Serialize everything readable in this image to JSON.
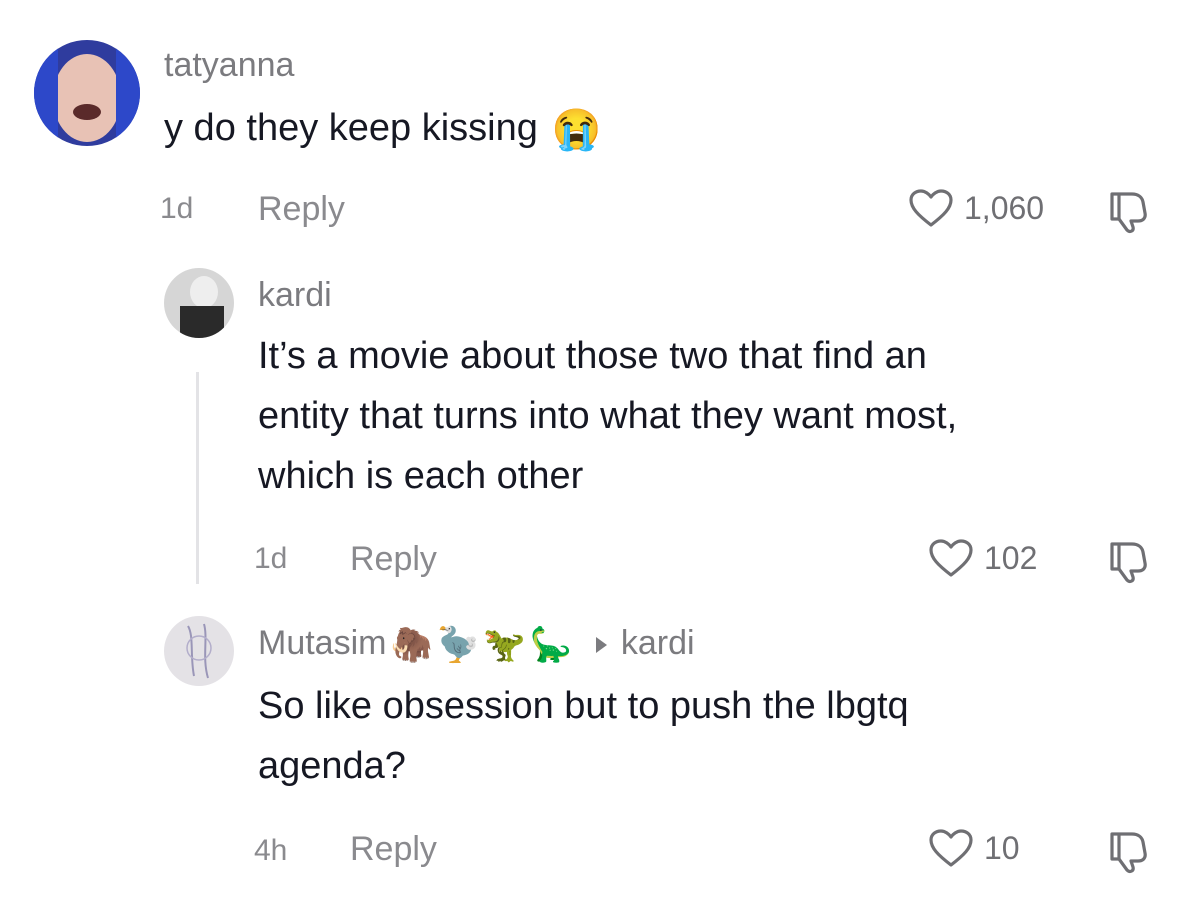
{
  "comments": [
    {
      "username": "tatyanna",
      "text": "y do they keep kissing",
      "emoji": "😭",
      "time": "1d",
      "reply_label": "Reply",
      "likes": "1,060"
    },
    {
      "username": "kardi",
      "text_lines": [
        "It’s a movie about those two that find an",
        "entity that turns into what they want most,",
        "which is each other"
      ],
      "time": "1d",
      "reply_label": "Reply",
      "likes": "102"
    },
    {
      "username": "Mutasim",
      "username_emojis": [
        "🦣",
        "🦤",
        "🦖",
        "🦕"
      ],
      "reply_to": "kardi",
      "text_lines": [
        "So like obsession but to push the lbgtq",
        "agenda?"
      ],
      "time": "4h",
      "reply_label": "Reply",
      "likes": "10"
    }
  ],
  "colors": {
    "username": "#7b7b7f",
    "text": "#161823",
    "meta": "#8a8a8e"
  }
}
